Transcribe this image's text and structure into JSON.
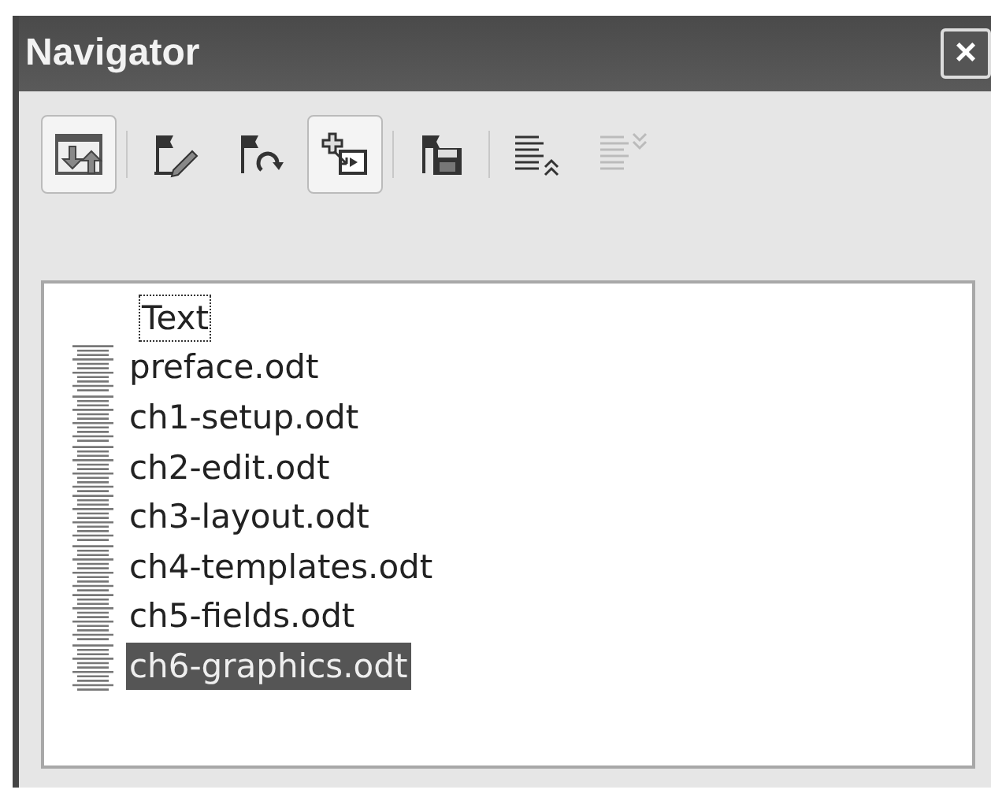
{
  "window": {
    "title": "Navigator",
    "close": "×"
  },
  "toolbar": [
    {
      "kind": "toggle",
      "pressed": true,
      "disabled": false
    },
    {
      "kind": "separator"
    },
    {
      "kind": "edit-flag",
      "pressed": false,
      "disabled": false
    },
    {
      "kind": "next-flag",
      "pressed": false,
      "disabled": false
    },
    {
      "kind": "insert",
      "pressed": true,
      "disabled": false
    },
    {
      "kind": "separator"
    },
    {
      "kind": "save-flag",
      "pressed": false,
      "disabled": false
    },
    {
      "kind": "separator"
    },
    {
      "kind": "move-up",
      "pressed": false,
      "disabled": false
    },
    {
      "kind": "move-down",
      "pressed": false,
      "disabled": true
    }
  ],
  "tree": [
    {
      "label": "Text",
      "focused": true,
      "selected": false,
      "children": [
        {
          "label": "preface.odt",
          "selected": false
        },
        {
          "label": "ch1-setup.odt",
          "selected": false
        },
        {
          "label": "ch2-edit.odt",
          "selected": false
        },
        {
          "label": "ch3-layout.odt",
          "selected": false
        },
        {
          "label": "ch4-templates.odt",
          "selected": false
        },
        {
          "label": "ch5-fields.odt",
          "selected": false
        },
        {
          "label": "ch6-graphics.odt",
          "selected": true
        }
      ]
    }
  ]
}
